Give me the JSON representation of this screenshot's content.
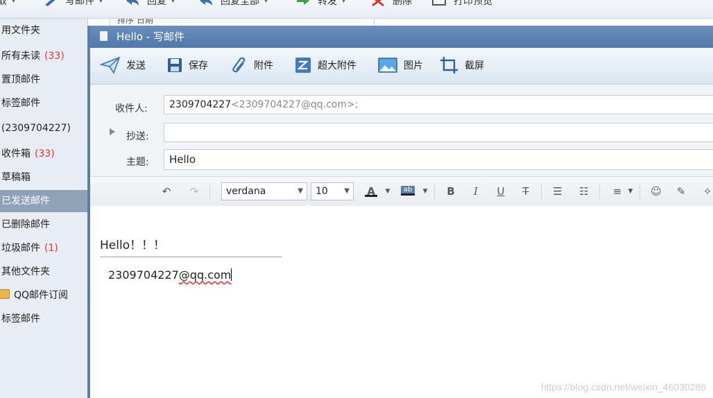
{
  "app_toolbar": {
    "items": [
      {
        "label": "收取"
      },
      {
        "label": "写邮件"
      },
      {
        "label": "回复"
      },
      {
        "label": "回复全部"
      },
      {
        "label": "转发"
      },
      {
        "label": "删除"
      },
      {
        "label": "打印预览"
      }
    ]
  },
  "sidebar": {
    "items": [
      {
        "label": "用文件夹",
        "count": ""
      },
      {
        "label": "所有未读",
        "count": "(33)"
      },
      {
        "label": "置顶邮件",
        "count": ""
      },
      {
        "label": "标签邮件",
        "count": ""
      },
      {
        "label": "(2309704227)",
        "count": ""
      },
      {
        "label": "收件箱",
        "count": "(33)"
      },
      {
        "label": "草稿箱",
        "count": ""
      },
      {
        "label": "已发送邮件",
        "count": "",
        "active": true
      },
      {
        "label": "已删除邮件",
        "count": ""
      },
      {
        "label": "垃圾邮件",
        "count": "(1)"
      },
      {
        "label": "其他文件夹",
        "count": ""
      },
      {
        "label": "QQ邮件订阅",
        "count": ""
      },
      {
        "label": "标签邮件",
        "count": ""
      }
    ]
  },
  "list_header": {
    "sort_label": "排序 日期"
  },
  "compose": {
    "title": "Hello - 写邮件",
    "toolbar": {
      "send": "发送",
      "save": "保存",
      "attach": "附件",
      "big_attach": "超大附件",
      "image": "图片",
      "screenshot": "截屏"
    },
    "to_label": "收件人:",
    "to_name": "2309704227",
    "to_addr": "<2309704227@qq.com>;",
    "cc_label": "抄送:",
    "cc_value": "",
    "subject_label": "主题:",
    "subject_value": "Hello",
    "format": {
      "font": "verdana",
      "size": "10"
    },
    "body_text": "Hello！！！",
    "signature_user": "2309704227",
    "signature_domain": "@qq.com"
  },
  "watermark": "https://blog.csdn.net/weixin_46030286",
  "colors": {
    "title_bar": "#5a80b0",
    "count_red": "#e0322e",
    "active_item": "#8fa2b6"
  }
}
